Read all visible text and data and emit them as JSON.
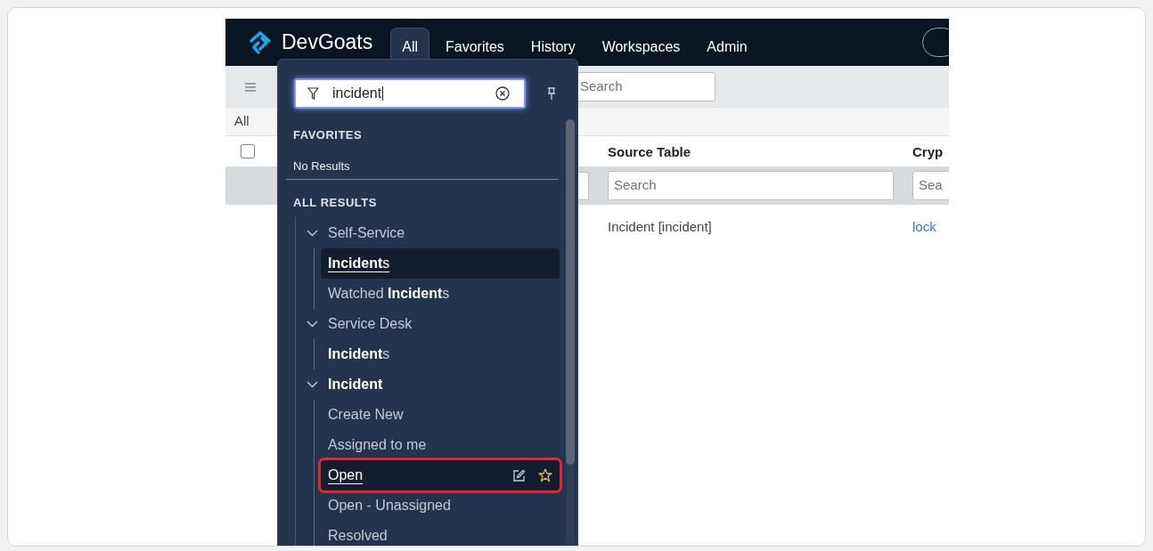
{
  "app": {
    "logo": "DevGoats"
  },
  "nav_tabs": [
    {
      "label": "All",
      "selected": true
    },
    {
      "label": "Favorites",
      "selected": false
    },
    {
      "label": "History",
      "selected": false
    },
    {
      "label": "Workspaces",
      "selected": false
    },
    {
      "label": "Admin",
      "selected": false
    }
  ],
  "toolbar": {
    "search_placeholder": "Search"
  },
  "list": {
    "breadcrumb": "All",
    "select_all": {
      "checked": false
    },
    "columns": [
      {
        "heading": "Source Table",
        "filter_placeholder": "Search"
      },
      {
        "heading": "Cryp",
        "filter_placeholder": "Sea"
      }
    ],
    "rows": [
      {
        "cells": [
          {
            "kind": "text",
            "text": "Incident [incident]"
          },
          {
            "kind": "link",
            "text": "lock"
          }
        ]
      }
    ]
  },
  "menu": {
    "filter": {
      "value": "incident"
    },
    "favorites": {
      "heading": "FAVORITES",
      "empty_text": "No Results"
    },
    "all_results": {
      "heading": "ALL RESULTS",
      "groups": [
        {
          "label": "Self-Service",
          "matched": false,
          "expanded": true,
          "children": [
            {
              "label": "**Incident**s",
              "selected": true,
              "highlighted": false
            },
            {
              "label": "Watched **Incident**s",
              "selected": false,
              "highlighted": false
            }
          ]
        },
        {
          "label": "Service Desk",
          "matched": false,
          "expanded": true,
          "children": [
            {
              "label": "**Incident**s",
              "selected": false,
              "highlighted": false
            }
          ]
        },
        {
          "label": "Incident",
          "matched": true,
          "expanded": true,
          "children": [
            {
              "label": "Create New",
              "selected": false,
              "highlighted": false
            },
            {
              "label": "Assigned to me",
              "selected": false,
              "highlighted": false
            },
            {
              "label": "Open",
              "selected": true,
              "highlighted": true
            },
            {
              "label": "Open - Unassigned",
              "selected": false,
              "highlighted": false
            },
            {
              "label": "Resolved",
              "selected": false,
              "highlighted": false
            }
          ]
        }
      ]
    }
  }
}
